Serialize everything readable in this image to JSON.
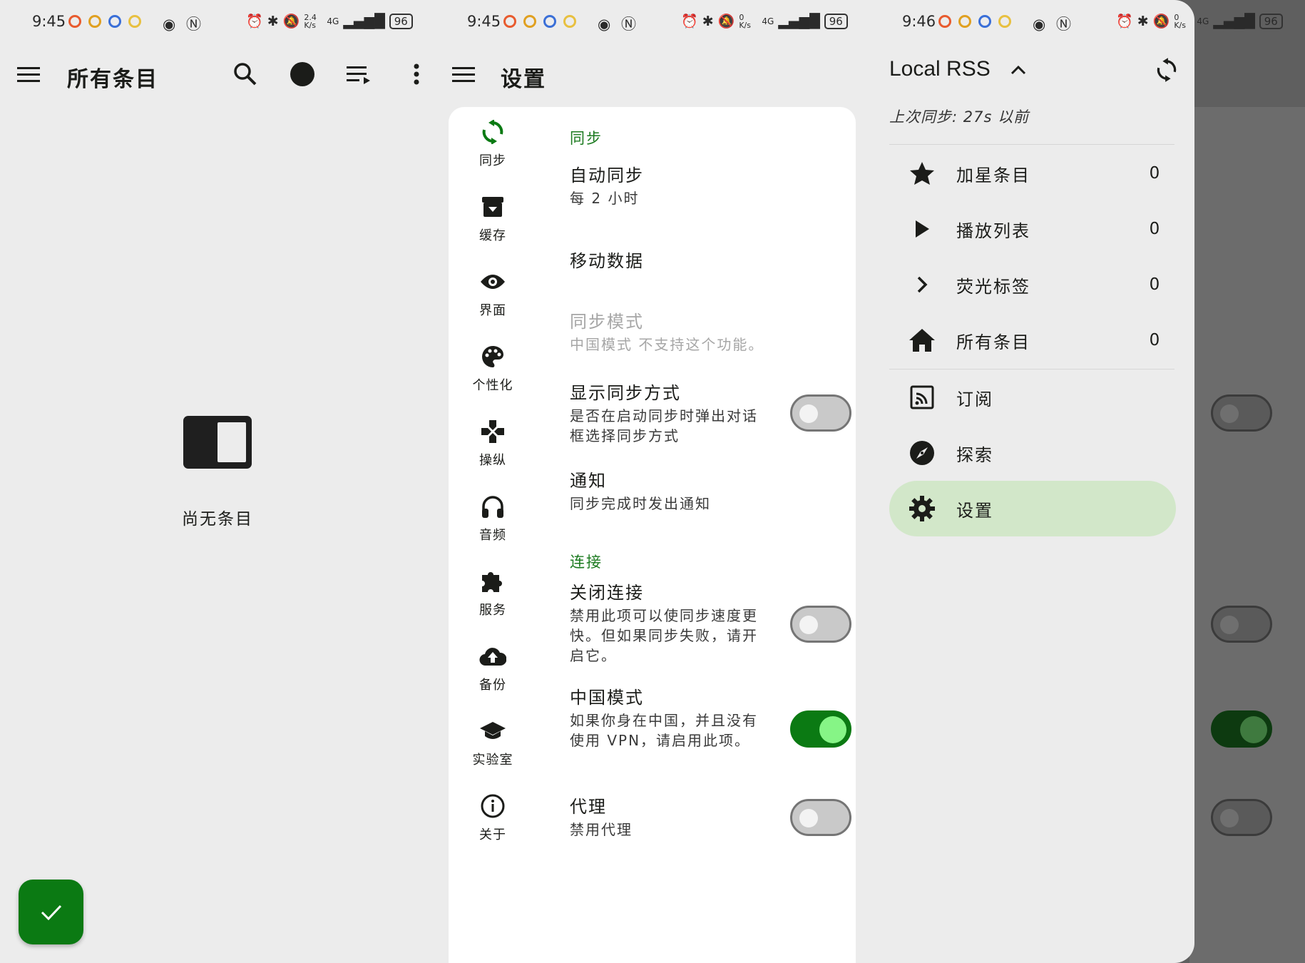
{
  "status_bars": [
    {
      "time": "9:45",
      "speed": "2.4 K/s",
      "network": "4G",
      "battery": "96"
    },
    {
      "time": "9:45",
      "speed": "0 K/s",
      "network": "4G",
      "battery": "96"
    },
    {
      "time": "9:46",
      "speed": "0 K/s",
      "network": "4G",
      "battery": "96"
    }
  ],
  "panel1": {
    "title": "所有条目",
    "empty_text": "尚无条目",
    "icons": [
      "menu-icon",
      "search-icon",
      "filled-circle-icon",
      "playlist-icon",
      "more-vert-icon",
      "check-icon"
    ]
  },
  "panel2": {
    "title": "设置",
    "nav": [
      {
        "label": "同步",
        "icon": "sync-icon"
      },
      {
        "label": "缓存",
        "icon": "archive-icon"
      },
      {
        "label": "界面",
        "icon": "eye-icon"
      },
      {
        "label": "个性化",
        "icon": "palette-icon"
      },
      {
        "label": "操纵",
        "icon": "gamepad-icon"
      },
      {
        "label": "音频",
        "icon": "headphones-icon"
      },
      {
        "label": "服务",
        "icon": "puzzle-icon"
      },
      {
        "label": "备份",
        "icon": "cloud-upload-icon"
      },
      {
        "label": "实验室",
        "icon": "school-icon"
      },
      {
        "label": "关于",
        "icon": "info-icon"
      }
    ],
    "sections": {
      "sync": "同步",
      "connection": "连接"
    },
    "settings": {
      "auto_sync": {
        "title": "自动同步",
        "desc": "每 2 小时"
      },
      "mobile_data": {
        "title": "移动数据"
      },
      "sync_mode": {
        "title": "同步模式",
        "desc": "中国模式 不支持这个功能。"
      },
      "show_sync_method": {
        "title": "显示同步方式",
        "desc": "是否在启动同步时弹出对话框选择同步方式",
        "enabled": false
      },
      "notify": {
        "title": "通知",
        "desc": "同步完成时发出通知"
      },
      "close_connection": {
        "title": "关闭连接",
        "desc": "禁用此项可以使同步速度更快。但如果同步失败，请开启它。",
        "enabled": false
      },
      "china_mode": {
        "title": "中国模式",
        "desc": "如果你身在中国，并且没有使用 VPN，请启用此项。",
        "enabled": true
      },
      "proxy": {
        "title": "代理",
        "desc": "禁用代理",
        "enabled": false
      }
    }
  },
  "panel3": {
    "account": "Local RSS",
    "last_sync": "上次同步: 27s 以前",
    "items": [
      {
        "label": "加星条目",
        "count": "0",
        "icon": "star-icon"
      },
      {
        "label": "播放列表",
        "count": "0",
        "icon": "play-icon"
      },
      {
        "label": "荧光标签",
        "count": "0",
        "icon": "chevron-right-icon"
      },
      {
        "label": "所有条目",
        "count": "0",
        "icon": "home-icon"
      },
      {
        "label": "订阅",
        "icon": "rss-feed-icon"
      },
      {
        "label": "探索",
        "icon": "compass-icon"
      },
      {
        "label": "设置",
        "icon": "gear-icon",
        "active": true
      }
    ]
  },
  "colors": {
    "accent": "#0b7a13",
    "section_header": "#1b7a1f",
    "active_nav": "#d2e7c9",
    "toggle_on_knob": "#86f586"
  }
}
